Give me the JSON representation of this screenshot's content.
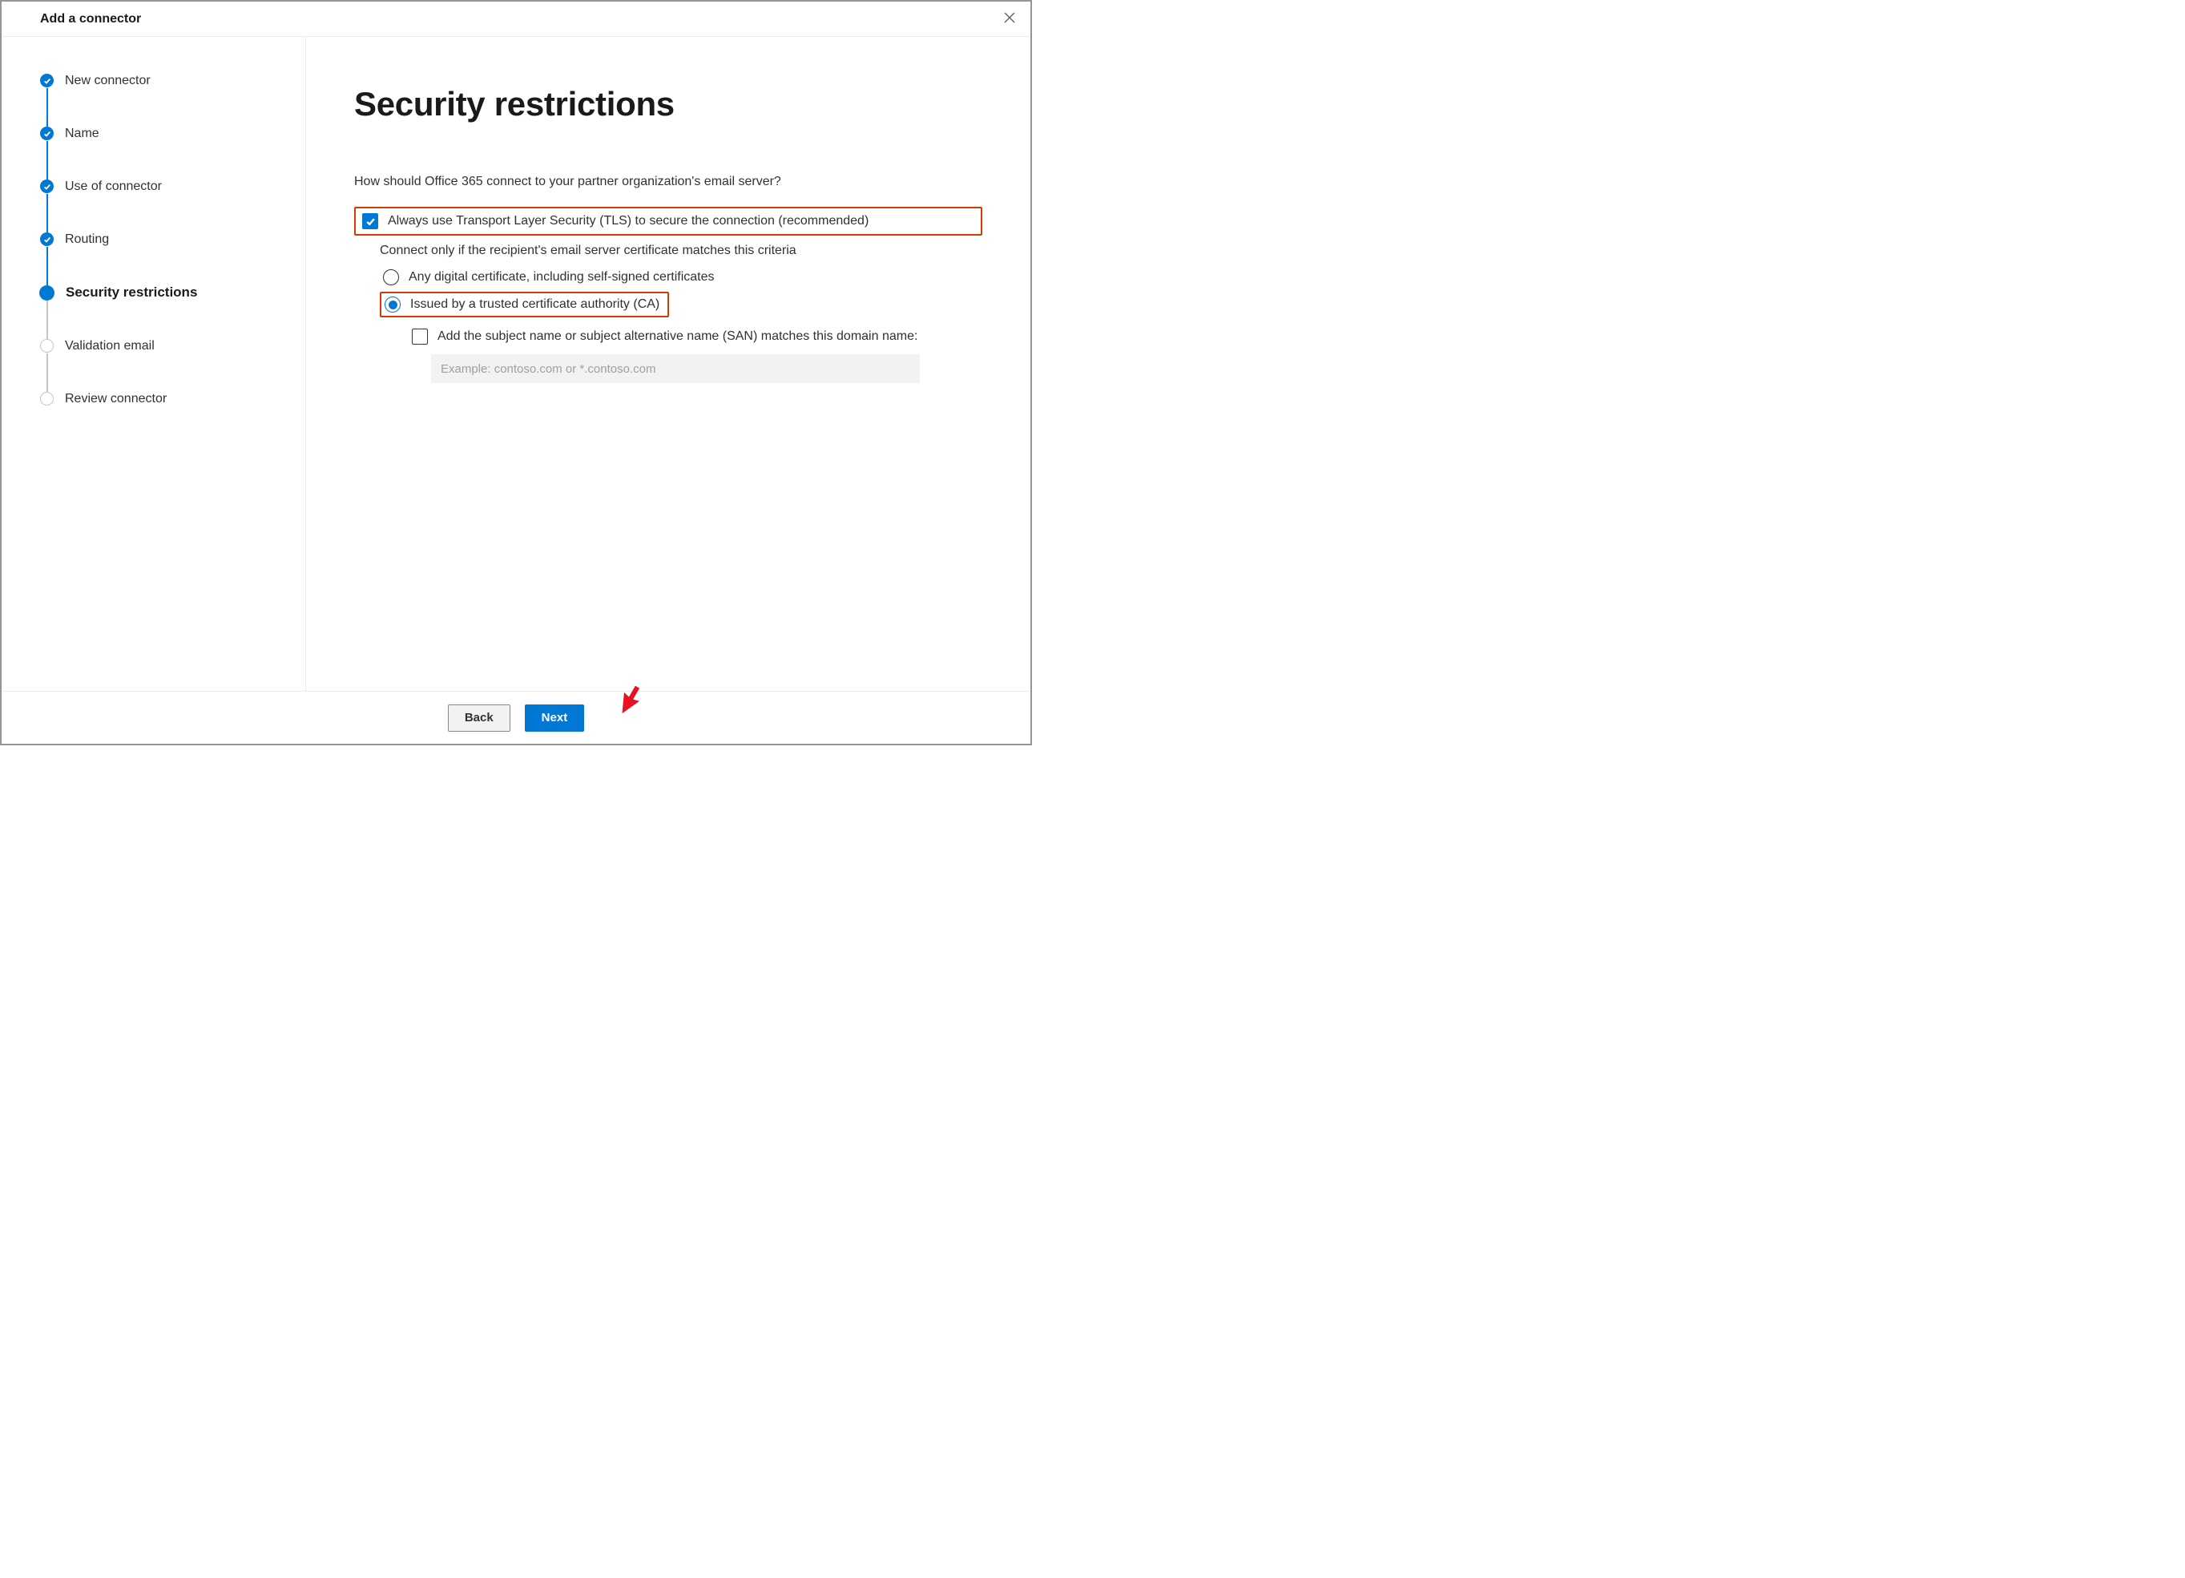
{
  "window": {
    "title": "Add a connector"
  },
  "steps": [
    {
      "label": "New connector",
      "state": "done"
    },
    {
      "label": "Name",
      "state": "done"
    },
    {
      "label": "Use of connector",
      "state": "done"
    },
    {
      "label": "Routing",
      "state": "done"
    },
    {
      "label": "Security restrictions",
      "state": "current"
    },
    {
      "label": "Validation email",
      "state": "future"
    },
    {
      "label": "Review connector",
      "state": "future"
    }
  ],
  "main": {
    "heading": "Security restrictions",
    "prompt": "How should Office 365 connect to your partner organization's email server?",
    "tls_checkbox": {
      "checked": true,
      "label": "Always use Transport Layer Security (TLS) to secure the connection (recommended)"
    },
    "cert_criteria_label": "Connect only if the recipient's email server certificate matches this criteria",
    "cert_radio": {
      "options": {
        "any": "Any digital certificate, including self-signed certificates",
        "trusted_ca": "Issued by a trusted certificate authority (CA)"
      },
      "selected": "trusted_ca"
    },
    "san_checkbox": {
      "checked": false,
      "label": "Add the subject name or subject alternative name (SAN) matches this domain name:"
    },
    "domain_input": {
      "value": "",
      "placeholder": "Example: contoso.com or *.contoso.com"
    }
  },
  "footer": {
    "back": "Back",
    "next": "Next"
  }
}
